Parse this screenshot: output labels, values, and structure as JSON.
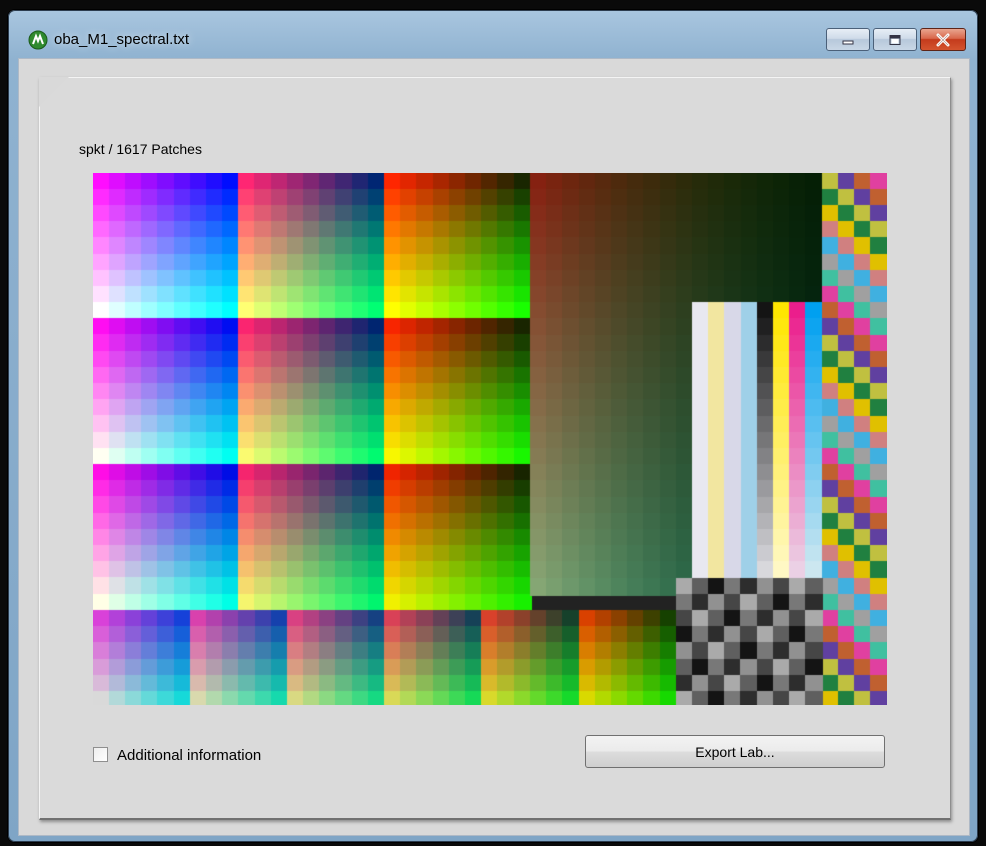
{
  "window": {
    "title": "oba_M1_spectral.txt",
    "icon": "green-app-icon",
    "controls": {
      "minimize": "minimize-icon",
      "maximize": "maximize-icon",
      "close": "close-icon"
    }
  },
  "panel": {
    "header": "spkt / 1617 Patches",
    "patch_count": 1617,
    "additional_info_label": "Additional information",
    "additional_info_checked": false,
    "export_button_label": "Export Lab..."
  },
  "colors": {
    "title_bar": "#8fb2d0",
    "close_button": "#c43b1c",
    "client_bg": "#d9d9d9"
  }
}
